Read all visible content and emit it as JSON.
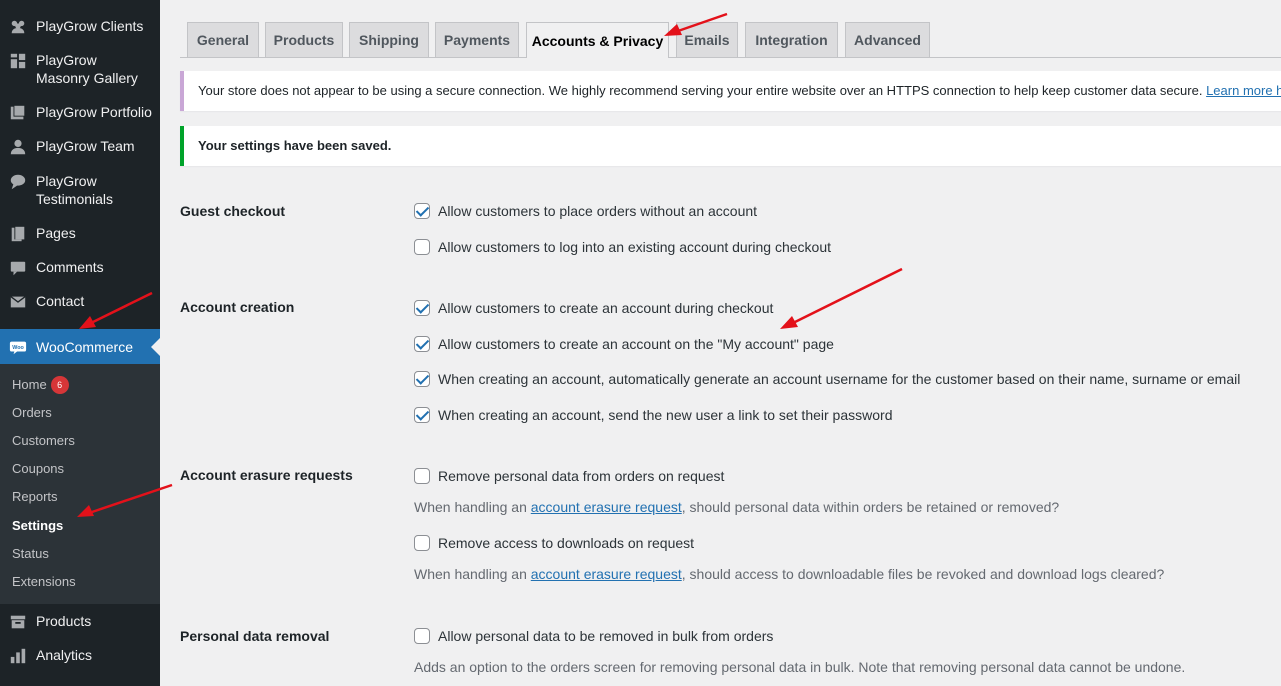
{
  "sidebar": {
    "items": [
      {
        "label": "PlayGrow Clients",
        "icon": "users-icon"
      },
      {
        "label": "PlayGrow Masonry Gallery",
        "icon": "grid-icon"
      },
      {
        "label": "PlayGrow Portfolio",
        "icon": "portfolio-icon"
      },
      {
        "label": "PlayGrow Team",
        "icon": "person-icon"
      },
      {
        "label": "PlayGrow Testimonials",
        "icon": "chat-icon"
      },
      {
        "label": "Pages",
        "icon": "pages-icon"
      },
      {
        "label": "Comments",
        "icon": "comment-icon"
      },
      {
        "label": "Contact",
        "icon": "mail-icon"
      },
      {
        "label": "WooCommerce",
        "icon": "woo-icon"
      }
    ],
    "submenu": [
      {
        "label": "Home",
        "badge": "6"
      },
      {
        "label": "Orders"
      },
      {
        "label": "Customers"
      },
      {
        "label": "Coupons"
      },
      {
        "label": "Reports"
      },
      {
        "label": "Settings"
      },
      {
        "label": "Status"
      },
      {
        "label": "Extensions"
      }
    ],
    "bottom_items": [
      {
        "label": "Products",
        "icon": "archive-icon"
      },
      {
        "label": "Analytics",
        "icon": "bar-chart-icon"
      }
    ],
    "active_color": "#2271b1"
  },
  "tabs": [
    "General",
    "Products",
    "Shipping",
    "Payments",
    "Accounts & Privacy",
    "Emails",
    "Integration",
    "Advanced"
  ],
  "active_tab": "Accounts & Privacy",
  "notices": {
    "warning_text": "Your store does not appear to be using a secure connection. We highly recommend serving your entire website over an HTTPS connection to help keep customer data secure.",
    "warning_link": "Learn more here",
    "saved_text": "Your settings have been saved."
  },
  "settings": {
    "guest_checkout": {
      "label": "Guest checkout",
      "options": [
        {
          "text": "Allow customers to place orders without an account",
          "checked": true
        },
        {
          "text": "Allow customers to log into an existing account during checkout",
          "checked": false
        }
      ]
    },
    "account_creation": {
      "label": "Account creation",
      "options": [
        {
          "text": "Allow customers to create an account during checkout",
          "checked": true
        },
        {
          "text": "Allow customers to create an account on the \"My account\" page",
          "checked": true
        },
        {
          "text": "When creating an account, automatically generate an account username for the customer based on their name, surname or email",
          "checked": true
        },
        {
          "text": "When creating an account, send the new user a link to set their password",
          "checked": true
        }
      ]
    },
    "erasure": {
      "label": "Account erasure requests",
      "opt1": {
        "text": "Remove personal data from orders on request",
        "checked": false
      },
      "desc1_pre": "When handling an ",
      "desc1_link": "account erasure request",
      "desc1_post": ", should personal data within orders be retained or removed?",
      "opt2": {
        "text": "Remove access to downloads on request",
        "checked": false
      },
      "desc2_pre": "When handling an ",
      "desc2_link": "account erasure request",
      "desc2_post": ", should access to downloadable files be revoked and download logs cleared?"
    },
    "removal": {
      "label": "Personal data removal",
      "opt1": {
        "text": "Allow personal data to be removed in bulk from orders",
        "checked": false
      },
      "desc": "Adds an option to the orders screen for removing personal data in bulk. Note that removing personal data cannot be undone."
    }
  },
  "annotation_color": "#e3111a"
}
